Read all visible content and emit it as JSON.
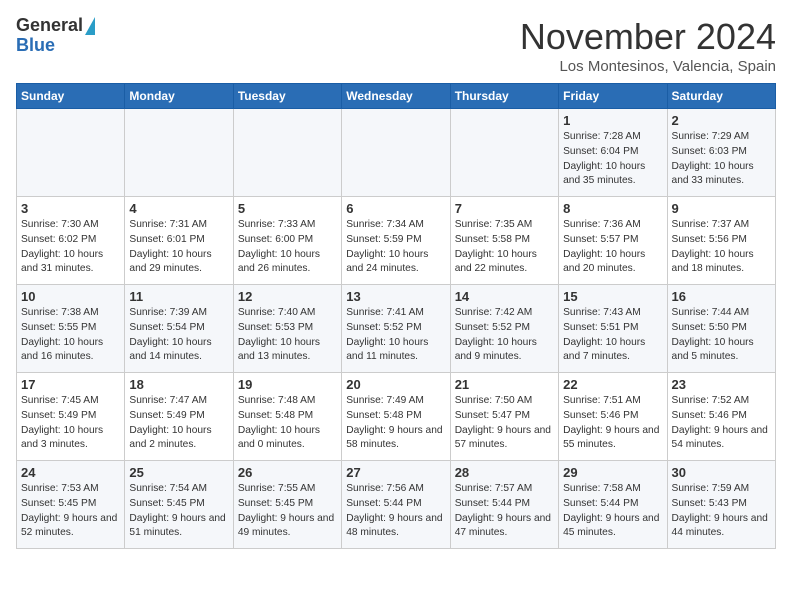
{
  "logo": {
    "general": "General",
    "blue": "Blue"
  },
  "title": "November 2024",
  "location": "Los Montesinos, Valencia, Spain",
  "headers": [
    "Sunday",
    "Monday",
    "Tuesday",
    "Wednesday",
    "Thursday",
    "Friday",
    "Saturday"
  ],
  "weeks": [
    [
      {
        "day": "",
        "info": ""
      },
      {
        "day": "",
        "info": ""
      },
      {
        "day": "",
        "info": ""
      },
      {
        "day": "",
        "info": ""
      },
      {
        "day": "",
        "info": ""
      },
      {
        "day": "1",
        "info": "Sunrise: 7:28 AM\nSunset: 6:04 PM\nDaylight: 10 hours and 35 minutes."
      },
      {
        "day": "2",
        "info": "Sunrise: 7:29 AM\nSunset: 6:03 PM\nDaylight: 10 hours and 33 minutes."
      }
    ],
    [
      {
        "day": "3",
        "info": "Sunrise: 7:30 AM\nSunset: 6:02 PM\nDaylight: 10 hours and 31 minutes."
      },
      {
        "day": "4",
        "info": "Sunrise: 7:31 AM\nSunset: 6:01 PM\nDaylight: 10 hours and 29 minutes."
      },
      {
        "day": "5",
        "info": "Sunrise: 7:33 AM\nSunset: 6:00 PM\nDaylight: 10 hours and 26 minutes."
      },
      {
        "day": "6",
        "info": "Sunrise: 7:34 AM\nSunset: 5:59 PM\nDaylight: 10 hours and 24 minutes."
      },
      {
        "day": "7",
        "info": "Sunrise: 7:35 AM\nSunset: 5:58 PM\nDaylight: 10 hours and 22 minutes."
      },
      {
        "day": "8",
        "info": "Sunrise: 7:36 AM\nSunset: 5:57 PM\nDaylight: 10 hours and 20 minutes."
      },
      {
        "day": "9",
        "info": "Sunrise: 7:37 AM\nSunset: 5:56 PM\nDaylight: 10 hours and 18 minutes."
      }
    ],
    [
      {
        "day": "10",
        "info": "Sunrise: 7:38 AM\nSunset: 5:55 PM\nDaylight: 10 hours and 16 minutes."
      },
      {
        "day": "11",
        "info": "Sunrise: 7:39 AM\nSunset: 5:54 PM\nDaylight: 10 hours and 14 minutes."
      },
      {
        "day": "12",
        "info": "Sunrise: 7:40 AM\nSunset: 5:53 PM\nDaylight: 10 hours and 13 minutes."
      },
      {
        "day": "13",
        "info": "Sunrise: 7:41 AM\nSunset: 5:52 PM\nDaylight: 10 hours and 11 minutes."
      },
      {
        "day": "14",
        "info": "Sunrise: 7:42 AM\nSunset: 5:52 PM\nDaylight: 10 hours and 9 minutes."
      },
      {
        "day": "15",
        "info": "Sunrise: 7:43 AM\nSunset: 5:51 PM\nDaylight: 10 hours and 7 minutes."
      },
      {
        "day": "16",
        "info": "Sunrise: 7:44 AM\nSunset: 5:50 PM\nDaylight: 10 hours and 5 minutes."
      }
    ],
    [
      {
        "day": "17",
        "info": "Sunrise: 7:45 AM\nSunset: 5:49 PM\nDaylight: 10 hours and 3 minutes."
      },
      {
        "day": "18",
        "info": "Sunrise: 7:47 AM\nSunset: 5:49 PM\nDaylight: 10 hours and 2 minutes."
      },
      {
        "day": "19",
        "info": "Sunrise: 7:48 AM\nSunset: 5:48 PM\nDaylight: 10 hours and 0 minutes."
      },
      {
        "day": "20",
        "info": "Sunrise: 7:49 AM\nSunset: 5:48 PM\nDaylight: 9 hours and 58 minutes."
      },
      {
        "day": "21",
        "info": "Sunrise: 7:50 AM\nSunset: 5:47 PM\nDaylight: 9 hours and 57 minutes."
      },
      {
        "day": "22",
        "info": "Sunrise: 7:51 AM\nSunset: 5:46 PM\nDaylight: 9 hours and 55 minutes."
      },
      {
        "day": "23",
        "info": "Sunrise: 7:52 AM\nSunset: 5:46 PM\nDaylight: 9 hours and 54 minutes."
      }
    ],
    [
      {
        "day": "24",
        "info": "Sunrise: 7:53 AM\nSunset: 5:45 PM\nDaylight: 9 hours and 52 minutes."
      },
      {
        "day": "25",
        "info": "Sunrise: 7:54 AM\nSunset: 5:45 PM\nDaylight: 9 hours and 51 minutes."
      },
      {
        "day": "26",
        "info": "Sunrise: 7:55 AM\nSunset: 5:45 PM\nDaylight: 9 hours and 49 minutes."
      },
      {
        "day": "27",
        "info": "Sunrise: 7:56 AM\nSunset: 5:44 PM\nDaylight: 9 hours and 48 minutes."
      },
      {
        "day": "28",
        "info": "Sunrise: 7:57 AM\nSunset: 5:44 PM\nDaylight: 9 hours and 47 minutes."
      },
      {
        "day": "29",
        "info": "Sunrise: 7:58 AM\nSunset: 5:44 PM\nDaylight: 9 hours and 45 minutes."
      },
      {
        "day": "30",
        "info": "Sunrise: 7:59 AM\nSunset: 5:43 PM\nDaylight: 9 hours and 44 minutes."
      }
    ]
  ]
}
